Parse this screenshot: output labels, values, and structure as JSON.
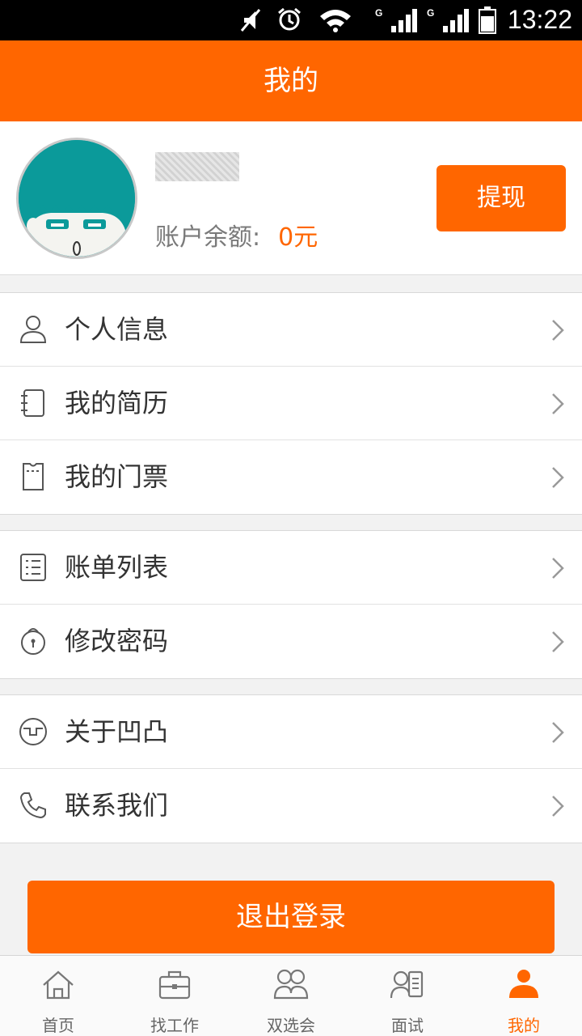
{
  "status_bar": {
    "time": "13:22"
  },
  "header": {
    "title": "我的"
  },
  "profile": {
    "balance_label": "账户余额:",
    "balance_value": "0元",
    "withdraw_label": "提现"
  },
  "menu_groups": [
    [
      {
        "label": "个人信息",
        "icon": "person-icon"
      },
      {
        "label": "我的简历",
        "icon": "notebook-icon"
      },
      {
        "label": "我的门票",
        "icon": "ticket-icon"
      }
    ],
    [
      {
        "label": "账单列表",
        "icon": "list-icon"
      },
      {
        "label": "修改密码",
        "icon": "lock-icon"
      }
    ],
    [
      {
        "label": "关于凹凸",
        "icon": "logo-icon"
      },
      {
        "label": "联系我们",
        "icon": "phone-icon"
      }
    ]
  ],
  "logout_label": "退出登录",
  "tabs": [
    {
      "label": "首页",
      "icon": "home-icon"
    },
    {
      "label": "找工作",
      "icon": "briefcase-icon"
    },
    {
      "label": "双选会",
      "icon": "people-icon"
    },
    {
      "label": "面试",
      "icon": "interview-icon"
    },
    {
      "label": "我的",
      "icon": "user-icon",
      "active": true
    }
  ],
  "colors": {
    "accent": "#ff6600",
    "background": "#f2f2f2"
  }
}
